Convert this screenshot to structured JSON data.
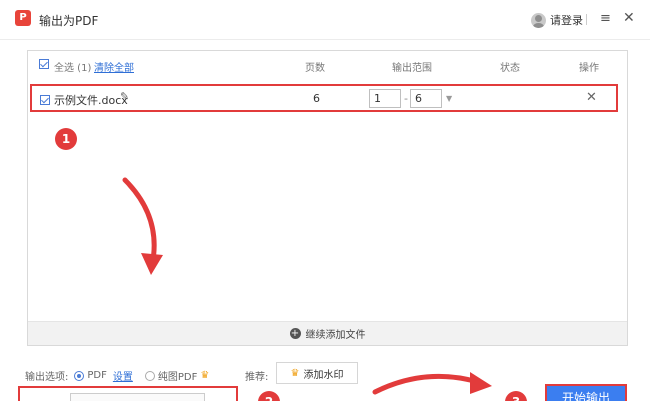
{
  "window": {
    "title": "输出为PDF",
    "app_icon_glyph": "P",
    "login_label": "请登录",
    "menu_icon": "hamburger-icon",
    "close_icon": "close-icon"
  },
  "table": {
    "select_all_label": "全选 (1)",
    "clear_all_label": "清除全部",
    "headers": {
      "pages": "页数",
      "range": "输出范围",
      "status": "状态",
      "action": "操作"
    },
    "rows": [
      {
        "filename": "示例文件.docx",
        "pages": "6",
        "range_from": "1",
        "range_to": "6",
        "status": "",
        "checked": true
      }
    ],
    "add_more_label": "继续添加文件"
  },
  "annotations": {
    "badge_1": "1",
    "badge_2": "2",
    "badge_3": "3",
    "highlight_color": "#e23b3b"
  },
  "options": {
    "label": "输出选项:",
    "pdf_label": "PDF",
    "pdf_settings_link": "设置",
    "image_pdf_label": "纯图PDF",
    "recommend_label": "推荐:",
    "watermark_button": "添加水印"
  },
  "start_button_label": "开始输出",
  "accent_color": "#3b7ef0"
}
